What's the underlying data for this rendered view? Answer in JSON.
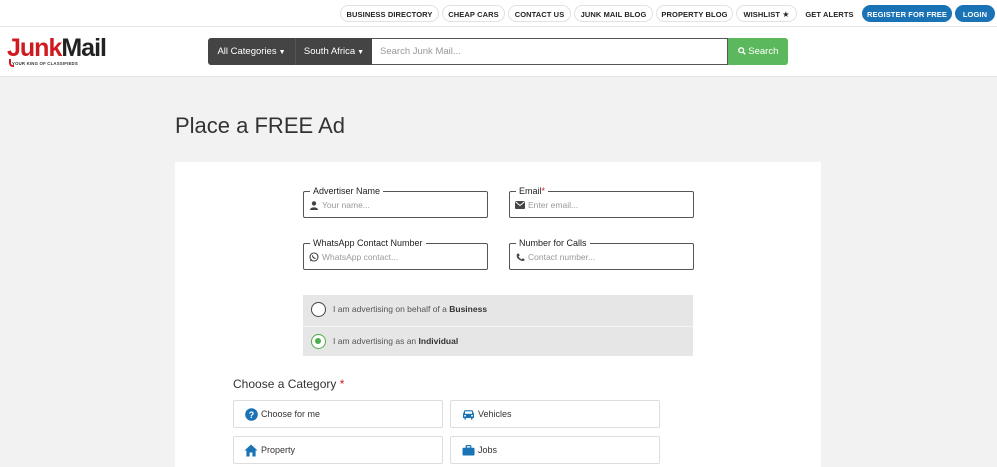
{
  "topnav": {
    "links": [
      {
        "label": "BUSINESS DIRECTORY"
      },
      {
        "label": "CHEAP CARS"
      },
      {
        "label": "CONTACT US"
      },
      {
        "label": "JUNK MAIL BLOG"
      },
      {
        "label": "PROPERTY BLOG"
      },
      {
        "label": "WISHLIST"
      },
      {
        "label": "GET ALERTS"
      },
      {
        "label": "REGISTER FOR FREE"
      },
      {
        "label": "LOGIN"
      }
    ]
  },
  "logo": {
    "part1": "Junk",
    "part2": "Mail",
    "tagline": "YOUR KING OF CLASSIFIEDS",
    "colors": {
      "red": "#d11a1f",
      "dark": "#222222"
    }
  },
  "search": {
    "category": "All Categories",
    "country": "South Africa",
    "placeholder": "Search Junk Mail...",
    "button": "Search",
    "button_color": "#5cb85c"
  },
  "page": {
    "title": "Place a FREE Ad"
  },
  "form": {
    "name": {
      "label": "Advertiser Name",
      "placeholder": "Your name...",
      "icon": "user-icon"
    },
    "email": {
      "label": "Email",
      "required": "*",
      "placeholder": "Enter email...",
      "icon": "envelope-icon"
    },
    "whatsapp": {
      "label": "WhatsApp Contact Number",
      "placeholder": "WhatsApp contact...",
      "icon": "whatsapp-icon"
    },
    "phone": {
      "label": "Number for Calls",
      "placeholder": "Contact number...",
      "icon": "phone-icon"
    },
    "advertiser_type": {
      "options": [
        {
          "prefix": "I am advertising on behalf of a ",
          "bold": "Business",
          "selected": false
        },
        {
          "prefix": "I am advertising as an ",
          "bold": "Individual",
          "selected": true
        }
      ]
    },
    "category": {
      "title": "Choose a Category",
      "required": "*",
      "items": [
        {
          "label": "Choose for me",
          "icon": "question-circle-icon"
        },
        {
          "label": "Vehicles",
          "icon": "car-icon"
        },
        {
          "label": "Property",
          "icon": "home-icon"
        },
        {
          "label": "Jobs",
          "icon": "briefcase-icon"
        }
      ]
    }
  },
  "colors": {
    "primary_blue": "#1a73b5",
    "accent_green": "#4cae4c",
    "brand_red": "#d11a1f"
  }
}
